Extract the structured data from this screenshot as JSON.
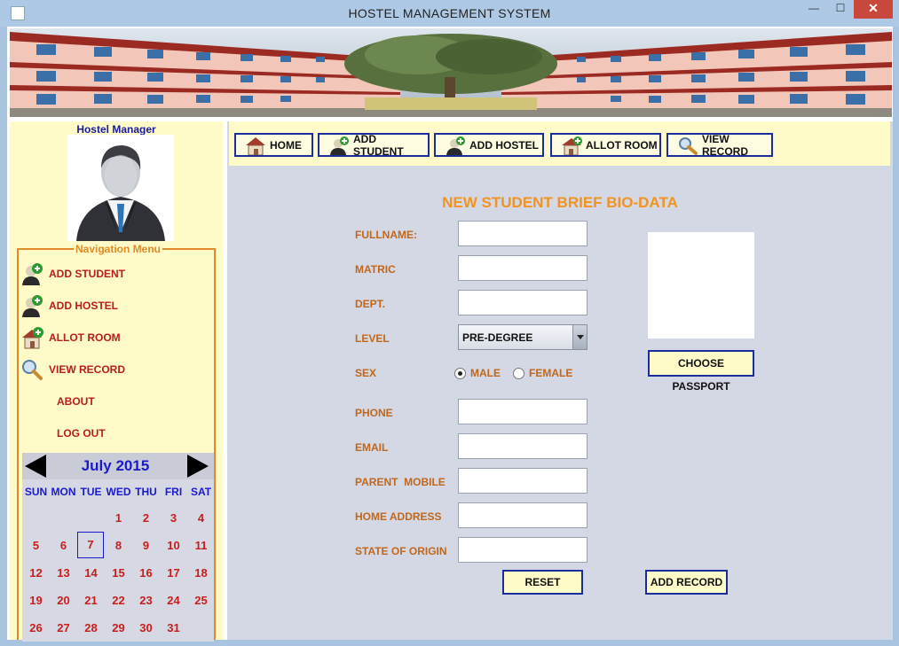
{
  "window": {
    "title": "HOSTEL MANAGEMENT SYSTEM",
    "minimize": "—",
    "maximize": "☐",
    "close": "✕"
  },
  "sidebar": {
    "manager_label": "Hostel Manager",
    "nav_title": "Navigation Menu",
    "items": [
      {
        "label": "ADD STUDENT",
        "icon": "add-user-icon"
      },
      {
        "label": "ADD HOSTEL",
        "icon": "add-user-icon"
      },
      {
        "label": "ALLOT ROOM",
        "icon": "house-add-icon"
      },
      {
        "label": "VIEW RECORD",
        "icon": "magnifier-icon"
      },
      {
        "label": "ABOUT",
        "icon": ""
      },
      {
        "label": "LOG OUT",
        "icon": ""
      }
    ]
  },
  "calendar": {
    "month_label": "July 2015",
    "weekdays": [
      "SUN",
      "MON",
      "TUE",
      "WED",
      "THU",
      "FRI",
      "SAT"
    ],
    "days": [
      "1",
      "2",
      "3",
      "4",
      "5",
      "6",
      "7",
      "8",
      "9",
      "10",
      "11",
      "12",
      "13",
      "14",
      "15",
      "16",
      "17",
      "18",
      "19",
      "20",
      "21",
      "22",
      "23",
      "24",
      "25",
      "26",
      "27",
      "28",
      "29",
      "30",
      "31"
    ],
    "selected_day": "7"
  },
  "toolbar": {
    "buttons": [
      {
        "label": "HOME",
        "icon": "home-icon"
      },
      {
        "label": "ADD STUDENT",
        "icon": "add-user-icon"
      },
      {
        "label": "ADD HOSTEL",
        "icon": "add-user-icon"
      },
      {
        "label": "ALLOT ROOM",
        "icon": "house-add-icon"
      },
      {
        "label": "VIEW RECORD",
        "icon": "magnifier-icon"
      }
    ]
  },
  "form": {
    "title": "NEW STUDENT BRIEF BIO-DATA",
    "fullname_label": "FULLNAME:",
    "fullname_value": "",
    "matric_label": "MATRIC",
    "matric_value": "",
    "dept_label": "DEPT.",
    "dept_value": "",
    "level_label": "LEVEL",
    "level_value": "PRE-DEGREE",
    "sex_label": "SEX",
    "sex_options": [
      "MALE",
      "FEMALE"
    ],
    "sex_selected": "MALE",
    "phone_label": "PHONE",
    "phone_value": "",
    "email_label": "EMAIL",
    "email_value": "",
    "parent_mobile_label": "PARENT  MOBILE",
    "parent_mobile_value": "",
    "home_address_label": "HOME ADDRESS",
    "home_address_value": "",
    "state_label": "STATE OF ORIGIN",
    "state_value": "",
    "choose_passport": "CHOOSE PASSPORT",
    "reset": "RESET",
    "add_record": "ADD RECORD"
  },
  "colors": {
    "accent_orange": "#f19320",
    "nav_red": "#b71d1d",
    "button_border": "#1b2d9c",
    "panel_yellow": "#fffbc9"
  }
}
